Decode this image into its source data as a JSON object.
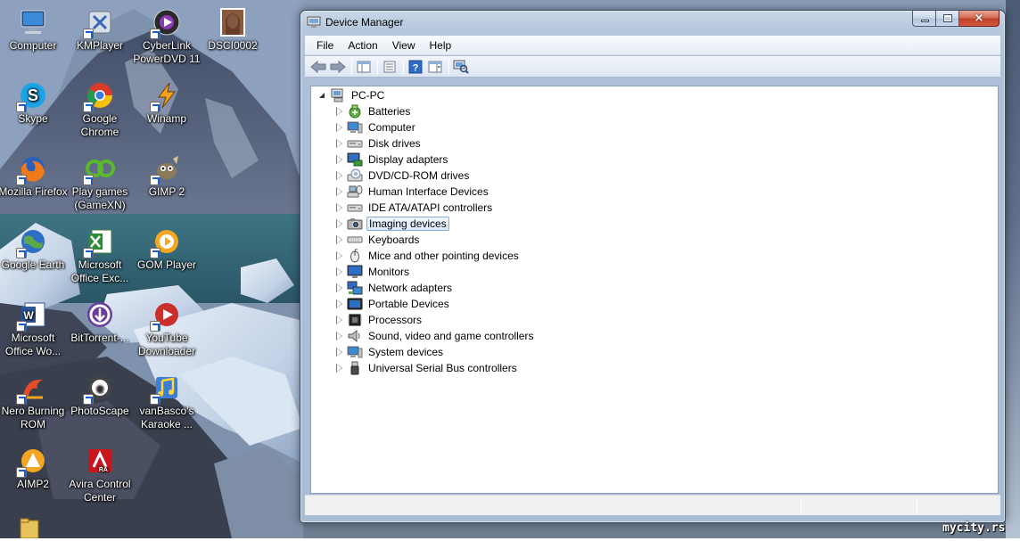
{
  "desktop": {
    "icons": [
      {
        "label": "Computer",
        "icon": "computer-icon"
      },
      {
        "label": "KMPlayer",
        "icon": "kmplayer-icon"
      },
      {
        "label": "CyberLink PowerDVD 11",
        "icon": "powerdvd-icon"
      },
      {
        "label": "DSCI0002",
        "icon": "photo-thumbnail-icon"
      },
      {
        "label": "Skype",
        "icon": "skype-icon"
      },
      {
        "label": "Google Chrome",
        "icon": "chrome-icon"
      },
      {
        "label": "Winamp",
        "icon": "winamp-icon"
      },
      {
        "label": "Mozilla Firefox",
        "icon": "firefox-icon"
      },
      {
        "label": "Play games (GameXN)",
        "icon": "gamexn-icon"
      },
      {
        "label": "GIMP 2",
        "icon": "gimp-icon"
      },
      {
        "label": "Google Earth",
        "icon": "google-earth-icon"
      },
      {
        "label": "Microsoft Office Exc...",
        "icon": "excel-icon"
      },
      {
        "label": "GOM Player",
        "icon": "gom-player-icon"
      },
      {
        "label": "Microsoft Office Wo...",
        "icon": "word-icon"
      },
      {
        "label": "BitTorrent-...",
        "icon": "bittorrent-icon"
      },
      {
        "label": "YouTube Downloader",
        "icon": "youtube-downloader-icon"
      },
      {
        "label": "Nero Burning ROM",
        "icon": "nero-icon"
      },
      {
        "label": "PhotoScape",
        "icon": "photoscape-icon"
      },
      {
        "label": "vanBasco's Karaoke ...",
        "icon": "vanbasco-icon"
      },
      {
        "label": "AIMP2",
        "icon": "aimp-icon"
      },
      {
        "label": "Avira Control Center",
        "icon": "avira-icon"
      }
    ]
  },
  "window": {
    "title": "Device Manager",
    "menu": [
      "File",
      "Action",
      "View",
      "Help"
    ],
    "toolbar": [
      "back-arrow-icon",
      "forward-arrow-icon",
      "show-hide-tree-icon",
      "properties-icon",
      "help-icon",
      "action-pane-icon",
      "scan-hardware-icon"
    ],
    "caption_close": "×"
  },
  "tree": {
    "root": "PC-PC",
    "items": [
      {
        "label": "Batteries",
        "icon": "battery-icon"
      },
      {
        "label": "Computer",
        "icon": "computer-icon"
      },
      {
        "label": "Disk drives",
        "icon": "disk-drive-icon"
      },
      {
        "label": "Display adapters",
        "icon": "display-adapter-icon"
      },
      {
        "label": "DVD/CD-ROM drives",
        "icon": "dvd-drive-icon"
      },
      {
        "label": "Human Interface Devices",
        "icon": "hid-icon"
      },
      {
        "label": "IDE ATA/ATAPI controllers",
        "icon": "ide-controller-icon"
      },
      {
        "label": "Imaging devices",
        "icon": "camera-icon",
        "selected": true
      },
      {
        "label": "Keyboards",
        "icon": "keyboard-icon"
      },
      {
        "label": "Mice and other pointing devices",
        "icon": "mouse-icon"
      },
      {
        "label": "Monitors",
        "icon": "monitor-icon"
      },
      {
        "label": "Network adapters",
        "icon": "network-adapter-icon"
      },
      {
        "label": "Portable Devices",
        "icon": "portable-device-icon"
      },
      {
        "label": "Processors",
        "icon": "processor-icon"
      },
      {
        "label": "Sound, video and game controllers",
        "icon": "speaker-icon"
      },
      {
        "label": "System devices",
        "icon": "system-device-icon"
      },
      {
        "label": "Universal Serial Bus controllers",
        "icon": "usb-icon"
      }
    ]
  },
  "watermark": "mycity.rs"
}
